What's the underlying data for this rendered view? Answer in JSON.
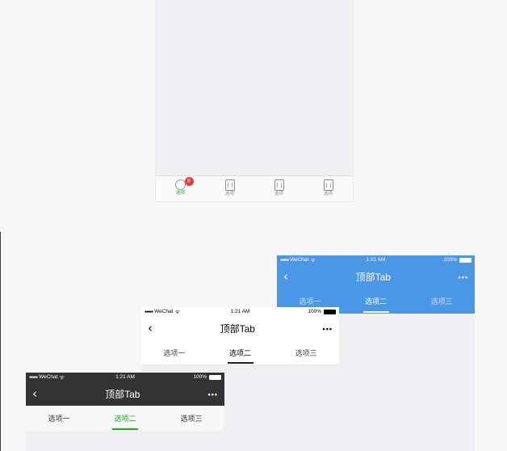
{
  "bottom_tab_screen": {
    "tabs": [
      {
        "label": "选项",
        "badge": "8",
        "active": true,
        "icon": "circle-icon"
      },
      {
        "label": "选项",
        "active": false,
        "icon": "square-icon"
      },
      {
        "label": "选项",
        "active": false,
        "icon": "square-icon"
      },
      {
        "label": "选项",
        "active": false,
        "icon": "square-icon"
      }
    ]
  },
  "status_bar": {
    "signal": "●●●●●",
    "carrier": "WeChat",
    "wifi": "ᯤ",
    "time": "1:21 AM",
    "battery": "100%"
  },
  "navbar": {
    "back": "‹",
    "title": "顶部Tab",
    "more": "•••"
  },
  "top_tabs": [
    "选项一",
    "选项二",
    "选项三"
  ],
  "variants": {
    "dark": {
      "active_index": 1,
      "accent": "#1aad19",
      "bar_color": "#333336"
    },
    "white": {
      "active_index": 1,
      "accent": "#222222",
      "bar_color": "#ffffff"
    },
    "blue": {
      "active_index": 1,
      "accent": "#ffffff",
      "bar_color": "#4a97e8"
    }
  }
}
